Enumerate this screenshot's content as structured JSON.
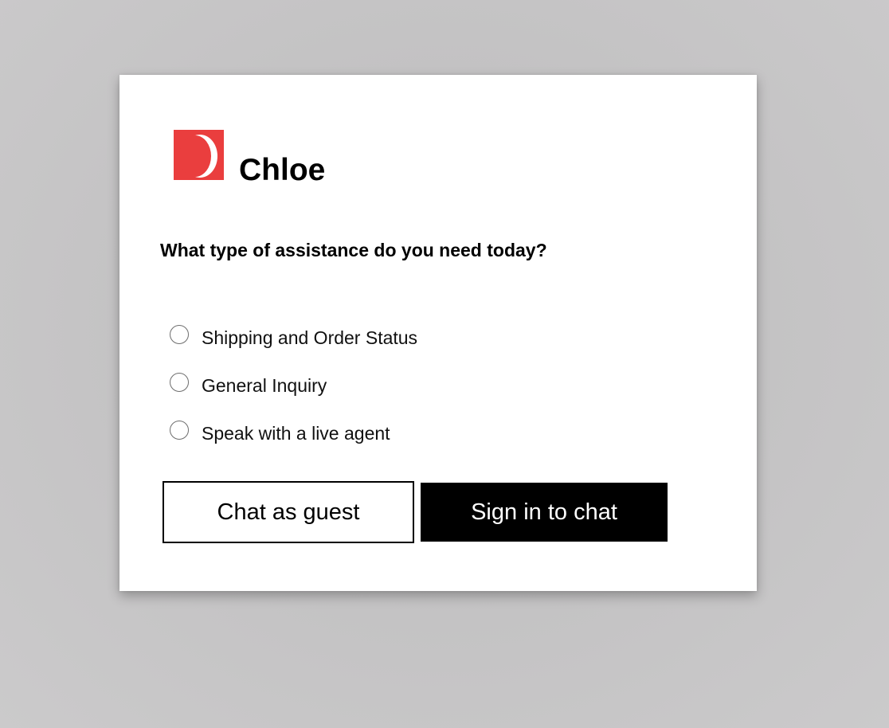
{
  "brand": {
    "name": "Chloe",
    "logo_icon": "overstock-o-logo-icon",
    "logo_color": "#ea3e3e"
  },
  "question": "What type of assistance do you need today?",
  "options": [
    {
      "label": "Shipping and Order Status",
      "selected": false
    },
    {
      "label": "General Inquiry",
      "selected": false
    },
    {
      "label": "Speak with a live agent",
      "selected": false
    }
  ],
  "buttons": {
    "guest_label": "Chat as guest",
    "signin_label": "Sign in to chat"
  }
}
